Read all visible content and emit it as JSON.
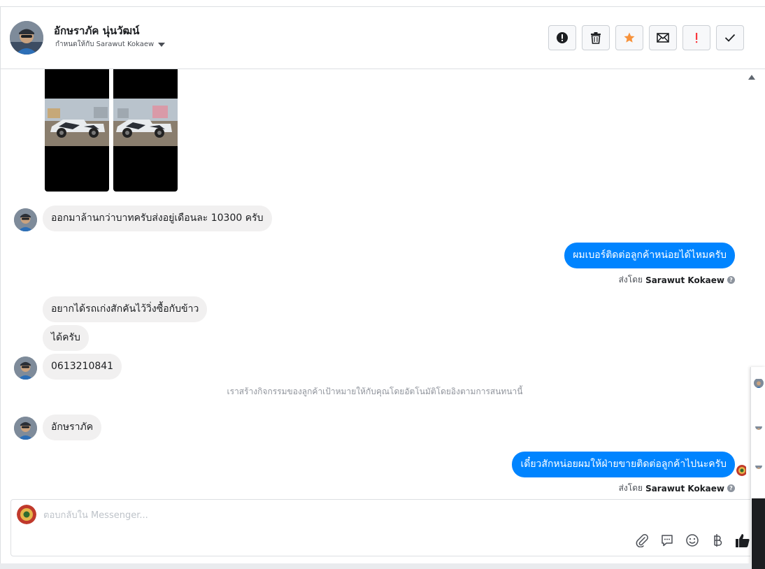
{
  "header": {
    "contact_name": "อักษราภัค นุ่นวัฒน์",
    "assign_label": "กำหนดให้กับ Sarawut Kokaew"
  },
  "actions": [
    {
      "name": "report-spam-icon"
    },
    {
      "name": "trash-icon"
    },
    {
      "name": "star-icon",
      "color": "#f7923b"
    },
    {
      "name": "mark-unread-icon"
    },
    {
      "name": "follow-up-icon",
      "color": "#fa383e"
    },
    {
      "name": "done-check-icon"
    }
  ],
  "messages": {
    "m1": "ออกมาล้านกว่าบาทครับส่งอยู่เดือนละ 10300 ครับ",
    "m2": "ผมเบอร์ติดต่อลูกค้าหน่อยได้ไหมครับ",
    "m3": "อยากได้รถเก่งสักคันไว้วิ่งซื้อกับข้าว",
    "m4": "ได้ครับ",
    "m5": "0613210841",
    "system_note": "เราสร้างกิจกรรมของลูกค้าเป้าหมายให้กับคุณโดยอัตโนมัติโดยอิงตามการสนทนานี้",
    "m6": "อักษราภัค",
    "m7": "เดี๋ยวสักหน่อยผมให้ฝ่ายขายติดต่อลูกค้าไปนะครับ"
  },
  "sent_by": {
    "prefix": "ส่งโดย",
    "name": "Sarawut Kokaew"
  },
  "composer": {
    "placeholder": "ตอบกลับใน Messenger..."
  },
  "colors": {
    "outgoing_bubble": "#0084ff",
    "incoming_bubble": "#f1f0f0"
  }
}
